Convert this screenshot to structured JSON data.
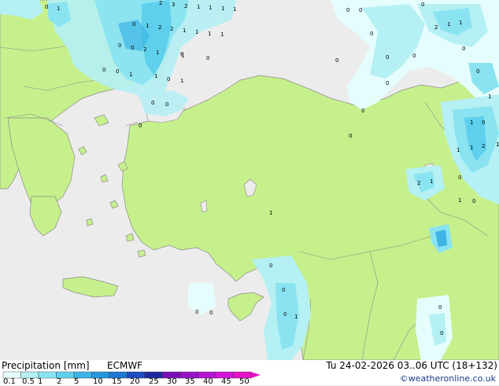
{
  "legend": {
    "title": "Precipitation [mm]",
    "model": "ECMWF",
    "datetime": "Tu 24-02-2026 03..06 UTC (18+132)",
    "credit": "©weatheronline.co.uk",
    "ticks": [
      "0.1",
      "0.5",
      "1",
      "2",
      "5",
      "10",
      "15",
      "20",
      "25",
      "30",
      "35",
      "40",
      "45",
      "50"
    ],
    "colors": [
      "#e6fdfd",
      "#b4f0f4",
      "#8ae3f0",
      "#5ed0ec",
      "#3cb4e6",
      "#2396dc",
      "#1e78d2",
      "#1e4bbe",
      "#1e28a0",
      "#780fb4",
      "#9614c8",
      "#b414d2",
      "#d214dc",
      "#e614c8"
    ]
  },
  "map_values": [
    {
      "t": "0"
    },
    {
      "t": "1"
    },
    {
      "t": "2"
    },
    {
      "t": "3"
    },
    {
      "t": "2"
    },
    {
      "t": "1"
    },
    {
      "t": "1"
    },
    {
      "t": "1"
    },
    {
      "t": "1"
    },
    {
      "t": "0"
    },
    {
      "t": "1"
    },
    {
      "t": "2"
    },
    {
      "t": "2"
    },
    {
      "t": "1"
    },
    {
      "t": "1"
    },
    {
      "t": "1"
    },
    {
      "t": "1"
    },
    {
      "t": "0"
    },
    {
      "t": "0"
    },
    {
      "t": "2"
    },
    {
      "t": "1"
    },
    {
      "t": "1"
    },
    {
      "t": "0"
    },
    {
      "t": "0"
    },
    {
      "t": "0"
    },
    {
      "t": "1"
    },
    {
      "t": "1"
    },
    {
      "t": "0"
    },
    {
      "t": "1"
    },
    {
      "t": "0"
    },
    {
      "t": "0"
    },
    {
      "t": "0"
    },
    {
      "t": "0"
    },
    {
      "t": "0"
    },
    {
      "t": "0"
    },
    {
      "t": "0"
    },
    {
      "t": "0"
    },
    {
      "t": "0"
    },
    {
      "t": "0"
    },
    {
      "t": "0"
    },
    {
      "t": "0"
    },
    {
      "t": "2"
    },
    {
      "t": "1"
    },
    {
      "t": "1"
    },
    {
      "t": "0"
    },
    {
      "t": "0"
    },
    {
      "t": "1"
    },
    {
      "t": "1"
    },
    {
      "t": "0"
    },
    {
      "t": "1"
    },
    {
      "t": "1"
    },
    {
      "t": "0"
    },
    {
      "t": "2"
    },
    {
      "t": "1"
    },
    {
      "t": "0"
    },
    {
      "t": "2"
    },
    {
      "t": "1"
    },
    {
      "t": "0"
    },
    {
      "t": "1"
    },
    {
      "t": "0"
    },
    {
      "t": "1"
    },
    {
      "t": "0"
    },
    {
      "t": "0"
    },
    {
      "t": "1"
    },
    {
      "t": "0"
    },
    {
      "t": "0"
    },
    {
      "t": "0"
    },
    {
      "t": "0"
    },
    {
      "t": "0"
    }
  ]
}
